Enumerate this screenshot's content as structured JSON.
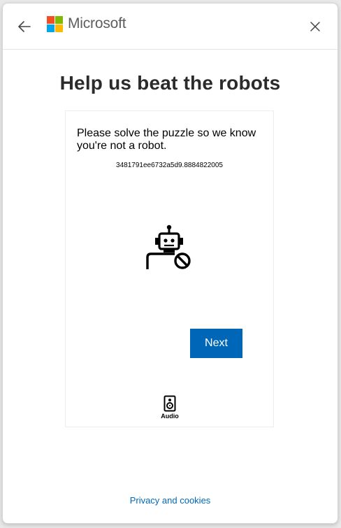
{
  "header": {
    "brand_name": "Microsoft",
    "logo_colors": [
      "#f25022",
      "#7fba00",
      "#00a4ef",
      "#ffb900"
    ],
    "back_icon": "arrow-left-icon",
    "close_icon": "close-icon"
  },
  "main": {
    "heading": "Help us beat the robots",
    "puzzle": {
      "prompt": "Please solve the puzzle so we know you're not a robot.",
      "session_id": "3481791ee6732a5d9.8884822005",
      "illustration_icon": "robot-blocked-icon",
      "next_label": "Next",
      "audio_label": "Audio",
      "audio_icon": "speaker-icon"
    }
  },
  "footer": {
    "privacy_link": "Privacy and cookies"
  },
  "colors": {
    "accent": "#0067b8",
    "heading_text": "#2b2b2b"
  }
}
